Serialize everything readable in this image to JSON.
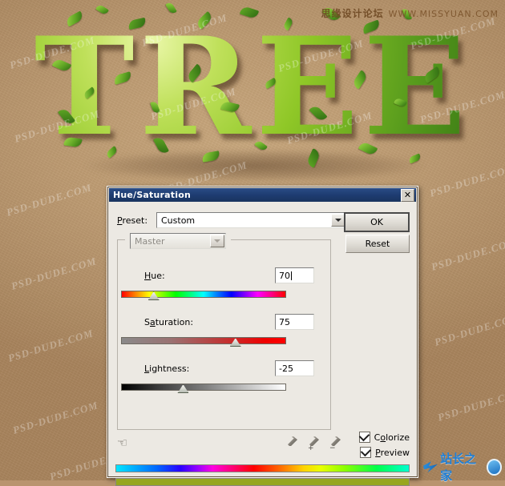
{
  "artwork": {
    "headline": "TREE",
    "watermark_top_cn": "思缘设计论坛",
    "watermark_top_url": "WWW.MISSYUAN.COM",
    "watermark_tile": "PSD-DUDE.COM",
    "logo_text": "站长之家"
  },
  "dialog": {
    "title": "Hue/Saturation",
    "close_label": "✕",
    "preset": {
      "label": "Preset:",
      "value": "Custom",
      "menu_icon": "preset-options-icon"
    },
    "buttons": {
      "ok": "OK",
      "reset": "Reset"
    },
    "channel": {
      "value": "Master"
    },
    "sliders": [
      {
        "id": "hue",
        "label": "Hue:",
        "value": "70",
        "thumb_percent": 19,
        "track": "hue-rainbow"
      },
      {
        "id": "saturation",
        "label": "Saturation:",
        "value": "75",
        "thumb_percent": 69,
        "track": "gray-to-red"
      },
      {
        "id": "lightness",
        "label": "Lightness:",
        "value": "-25",
        "thumb_percent": 37,
        "track": "black-to-white"
      }
    ],
    "tools": {
      "hand_icon": "hand-scrubby-icon",
      "eyedroppers": [
        {
          "name": "eyedropper-sample",
          "sign": ""
        },
        {
          "name": "eyedropper-add",
          "sign": "+"
        },
        {
          "name": "eyedropper-subtract",
          "sign": "−"
        }
      ]
    },
    "checkboxes": [
      {
        "id": "colorize",
        "label": "Colorize",
        "checked": true
      },
      {
        "id": "preview",
        "label": "Preview",
        "checked": true
      }
    ],
    "bars": {
      "spectrum_name": "input-spectrum-bar",
      "result_name": "output-color-bar",
      "result_color": "#97a61f"
    }
  }
}
